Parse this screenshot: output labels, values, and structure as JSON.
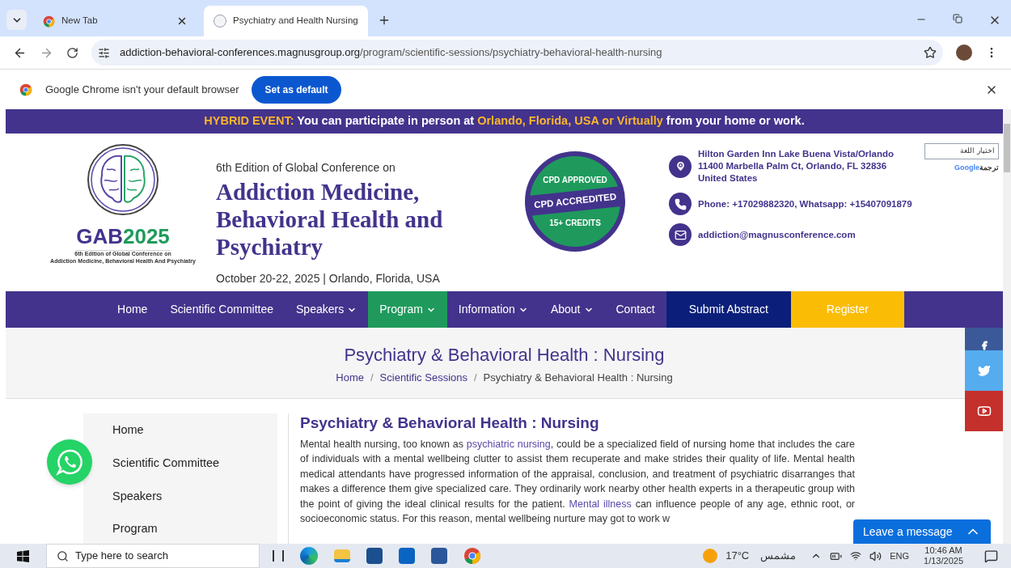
{
  "browser": {
    "tabs": [
      {
        "title": "New Tab",
        "selected": false
      },
      {
        "title": "Psychiatry and Health Nursing",
        "selected": true
      }
    ],
    "address": {
      "domain": "addiction-behavioral-conferences.magnusgroup.org",
      "path": "/program/scientific-sessions/psychiatry-behavioral-health-nursing"
    },
    "infobar": {
      "message": "Google Chrome isn't your default browser",
      "button": "Set as default"
    }
  },
  "banner": [
    {
      "text": "HYBRID EVENT:",
      "highlight": true
    },
    {
      "text": " You can participate in person at ",
      "highlight": false
    },
    {
      "text": "Orlando, Florida, USA or Virtually",
      "highlight": true
    },
    {
      "text": " from your home or work.",
      "highlight": false
    }
  ],
  "logo": {
    "letters": "GAB",
    "year": "2025",
    "caption_1": "6th Edition of Global Conference on",
    "caption_2": "Addiction Medicine, Behavioral Health And Psychiatry"
  },
  "conference": {
    "edition": "6th Edition of Global Conference on",
    "title": "Addiction Medicine, Behavioral Health and Psychiatry",
    "dates": "October 20-22, 2025 | Orlando, Florida, USA"
  },
  "cpd_badge": {
    "top": "CPD APPROVED",
    "middle": "CPD ACCREDITED",
    "bottom": "15+ CREDITS"
  },
  "contacts": [
    {
      "kind": "location",
      "lines": [
        "Hilton Garden Inn Lake Buena Vista/Orlando",
        "11400 Marbella Palm Ct, Orlando, FL 32836",
        "United States"
      ]
    },
    {
      "kind": "phone",
      "lines": [
        "Phone: +17029882320, Whatsapp: +15407091879"
      ]
    },
    {
      "kind": "email",
      "lines": [
        "addiction@magnusconference.com"
      ]
    }
  ],
  "translate": {
    "select": "اختيار اللغة",
    "brand": "Google",
    "label": "ترجمة"
  },
  "nav": [
    {
      "label": "Home",
      "kind": "link",
      "dropdown": false,
      "selected": false
    },
    {
      "label": "Scientific Committee",
      "kind": "link",
      "dropdown": false,
      "selected": false
    },
    {
      "label": "Speakers",
      "kind": "link",
      "dropdown": true,
      "selected": false
    },
    {
      "label": "Program",
      "kind": "link",
      "dropdown": true,
      "selected": true
    },
    {
      "label": "Information",
      "kind": "link",
      "dropdown": true,
      "selected": false
    },
    {
      "label": "About",
      "kind": "link",
      "dropdown": true,
      "selected": false
    },
    {
      "label": "Contact",
      "kind": "link",
      "dropdown": false,
      "selected": false
    },
    {
      "label": "Submit Abstract",
      "kind": "submit",
      "dropdown": false,
      "selected": false
    },
    {
      "label": "Register",
      "kind": "register",
      "dropdown": false,
      "selected": false
    }
  ],
  "page_header": {
    "title": "Psychiatry & Behavioral Health : Nursing",
    "breadcrumbs": [
      "Home",
      "Scientific Sessions",
      "Psychiatry & Behavioral Health : Nursing"
    ],
    "separator": "/"
  },
  "sidebar": {
    "items": [
      "Home",
      "Scientific Committee",
      "Speakers",
      "Program"
    ]
  },
  "article": {
    "heading": "Psychiatry & Behavioral Health : Nursing",
    "parts": [
      {
        "kind": "text",
        "text": "Mental health nursing, too known as "
      },
      {
        "kind": "link",
        "text": "psychiatric nursing"
      },
      {
        "kind": "text",
        "text": ", could be a specialized field of nursing home that includes the care of individuals with a mental wellbeing clutter to assist them recuperate and make strides their quality of life. Mental health medical attendants have progressed information of the appraisal, conclusion, and treatment of psychiatric disarranges that makes a difference them give specialized care. They ordinarily work nearby other health experts in a therapeutic group with the point of giving the ideal clinical results for the patient. "
      },
      {
        "kind": "link",
        "text": "Mental illness"
      },
      {
        "kind": "text",
        "text": " can influence people of any age, ethnic root, or socioeconomic status. For this reason, mental wellbeing nurture may got to work w"
      }
    ]
  },
  "chat_widget": {
    "label": "Leave a message"
  },
  "taskbar": {
    "search": "Type here to search",
    "temperature": "17°C",
    "weather": "مشمس",
    "language": "ENG",
    "time": "10:46 AM",
    "date": "1/13/2025"
  }
}
